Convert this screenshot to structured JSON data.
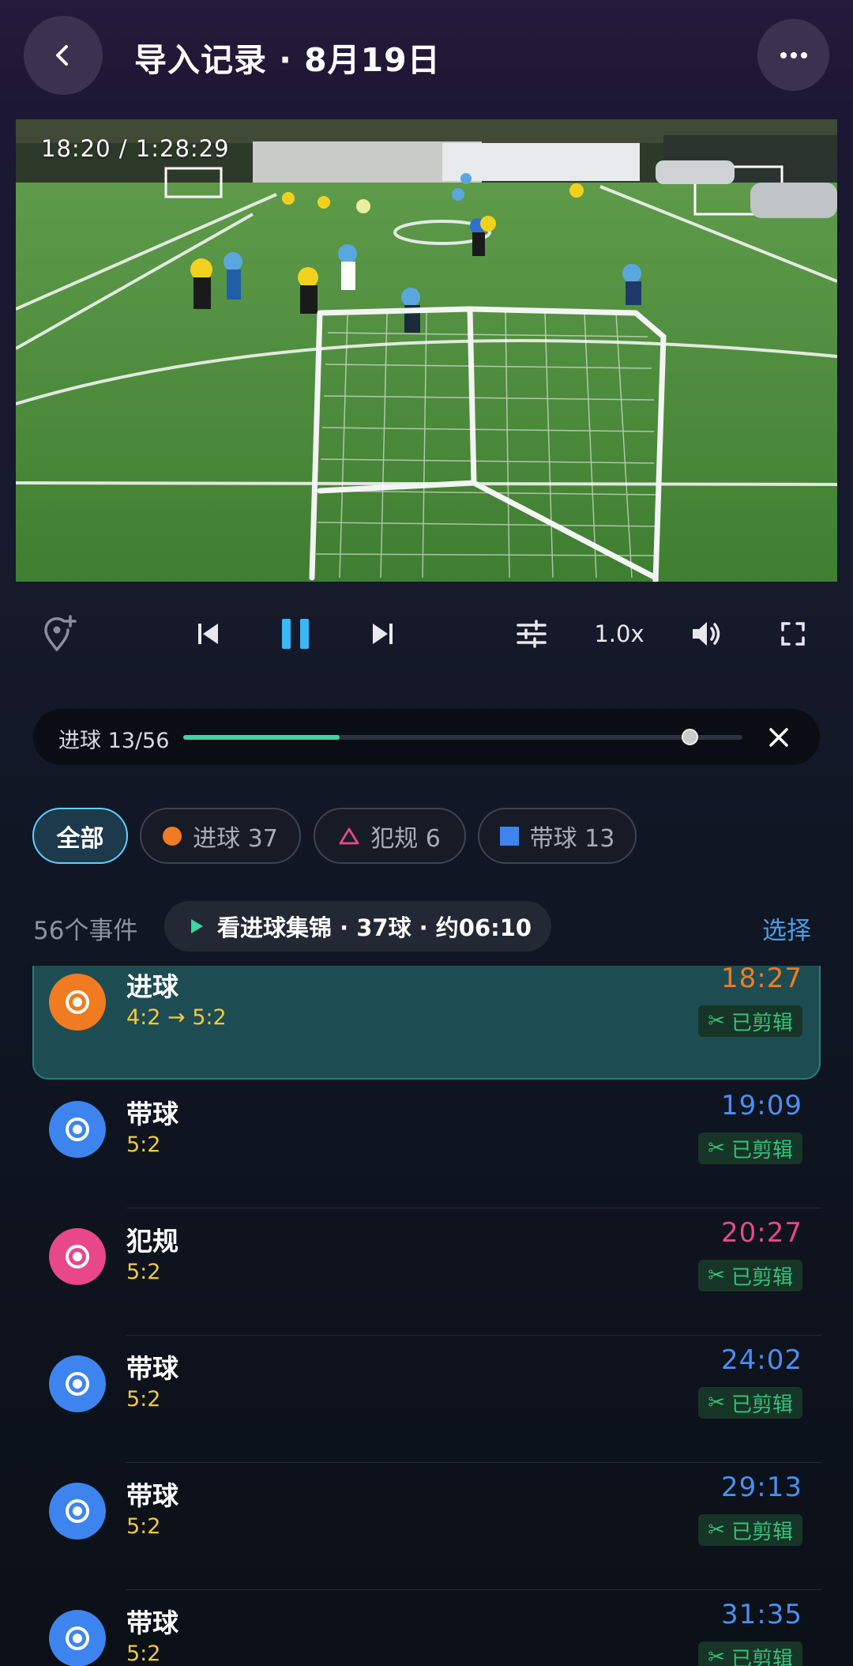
{
  "header": {
    "title": "导入记录 · 8月19日"
  },
  "video": {
    "time_display": "18:20 / 1:28:29"
  },
  "controls": {
    "speed": "1.0x"
  },
  "progress": {
    "label": "进球 13/56",
    "played_fraction": 0.28,
    "knob_fraction": 0.905
  },
  "filters": [
    {
      "label": "全部",
      "active": true
    },
    {
      "label": "进球 37",
      "marker": "dot",
      "color": "#f07b20"
    },
    {
      "label": "犯规 6",
      "marker": "triangle",
      "color": "#e8488a"
    },
    {
      "label": "带球 13",
      "marker": "square",
      "color": "#3d84ef"
    }
  ],
  "list_header": {
    "count": "56个事件",
    "highlight": "看进球集锦 · 37球 · 约06:10",
    "select": "选择"
  },
  "events": [
    {
      "type": "进球",
      "score": "4:2 → 5:2",
      "time": "18:27",
      "badge": "已剪辑",
      "color": "#f07b20",
      "active": true
    },
    {
      "type": "带球",
      "score": "5:2",
      "time": "19:09",
      "badge": "已剪辑",
      "color": "#3d84ef"
    },
    {
      "type": "犯规",
      "score": "5:2",
      "time": "20:27",
      "badge": "已剪辑",
      "color": "#e8488a"
    },
    {
      "type": "带球",
      "score": "5:2",
      "time": "24:02",
      "badge": "已剪辑",
      "color": "#3d84ef"
    },
    {
      "type": "带球",
      "score": "5:2",
      "time": "29:13",
      "badge": "已剪辑",
      "color": "#3d84ef"
    },
    {
      "type": "带球",
      "score": "5:2",
      "time": "31:35",
      "badge": "已剪辑",
      "color": "#3d84ef"
    }
  ],
  "icons": {
    "back": "chevron-left-icon",
    "more": "more-dots-icon",
    "add_marker": "location-plus-icon",
    "previous": "skip-previous-icon",
    "pause": "pause-icon",
    "next": "skip-next-icon",
    "adjust": "sliders-icon",
    "volume": "volume-icon",
    "fullscreen": "fullscreen-icon",
    "close": "close-icon",
    "scissors": "scissors-icon"
  }
}
